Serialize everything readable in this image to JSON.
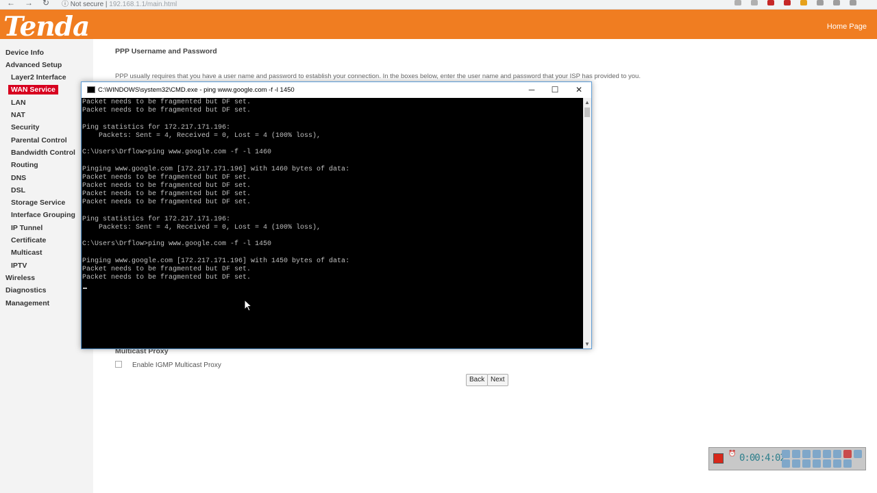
{
  "browser": {
    "security_label": "Not secure",
    "url": "192.168.1.1/main.html"
  },
  "header": {
    "logo_text": "Tenda",
    "home_link": "Home Page",
    "brand_color": "#f07d21"
  },
  "sidebar": {
    "items": [
      {
        "label": "Device Info"
      },
      {
        "label": "Advanced Setup"
      },
      {
        "label": "Layer2 Interface"
      },
      {
        "label": "WAN Service"
      },
      {
        "label": "LAN"
      },
      {
        "label": "NAT"
      },
      {
        "label": "Security"
      },
      {
        "label": "Parental Control"
      },
      {
        "label": "Bandwidth Control"
      },
      {
        "label": "Routing"
      },
      {
        "label": "DNS"
      },
      {
        "label": "DSL"
      },
      {
        "label": "Storage Service"
      },
      {
        "label": "Interface Grouping"
      },
      {
        "label": "IP Tunnel"
      },
      {
        "label": "Certificate"
      },
      {
        "label": "Multicast"
      },
      {
        "label": "IPTV"
      },
      {
        "label": "Wireless"
      },
      {
        "label": "Diagnostics"
      },
      {
        "label": "Management"
      }
    ],
    "active_color": "#d7001f"
  },
  "main": {
    "title": "PPP Username and Password",
    "description": "PPP usually requires that you have a user name and password to establish your connection. In the boxes below, enter the user name and password that your ISP has provided to you.",
    "multicast_title": "Multicast Proxy",
    "igmp_label": "Enable IGMP Multicast Proxy",
    "igmp_checked": false,
    "back_label": "Back",
    "next_label": "Next"
  },
  "cmd": {
    "title": "C:\\WINDOWS\\system32\\CMD.exe - ping  www.google.com -f -l 1450",
    "minimize": "─",
    "maximize": "☐",
    "close": "✕",
    "output": "Packet needs to be fragmented but DF set.\nPacket needs to be fragmented but DF set.\n\nPing statistics for 172.217.171.196:\n    Packets: Sent = 4, Received = 0, Lost = 4 (100% loss),\n\nC:\\Users\\Drflow>ping www.google.com -f -l 1460\n\nPinging www.google.com [172.217.171.196] with 1460 bytes of data:\nPacket needs to be fragmented but DF set.\nPacket needs to be fragmented but DF set.\nPacket needs to be fragmented but DF set.\nPacket needs to be fragmented but DF set.\n\nPing statistics for 172.217.171.196:\n    Packets: Sent = 4, Received = 0, Lost = 4 (100% loss),\n\nC:\\Users\\Drflow>ping www.google.com -f -l 1450\n\nPinging www.google.com [172.217.171.196] with 1450 bytes of data:\nPacket needs to be fragmented but DF set.\nPacket needs to be fragmented but DF set."
  },
  "recorder": {
    "elapsed": "0:00:4:02"
  }
}
